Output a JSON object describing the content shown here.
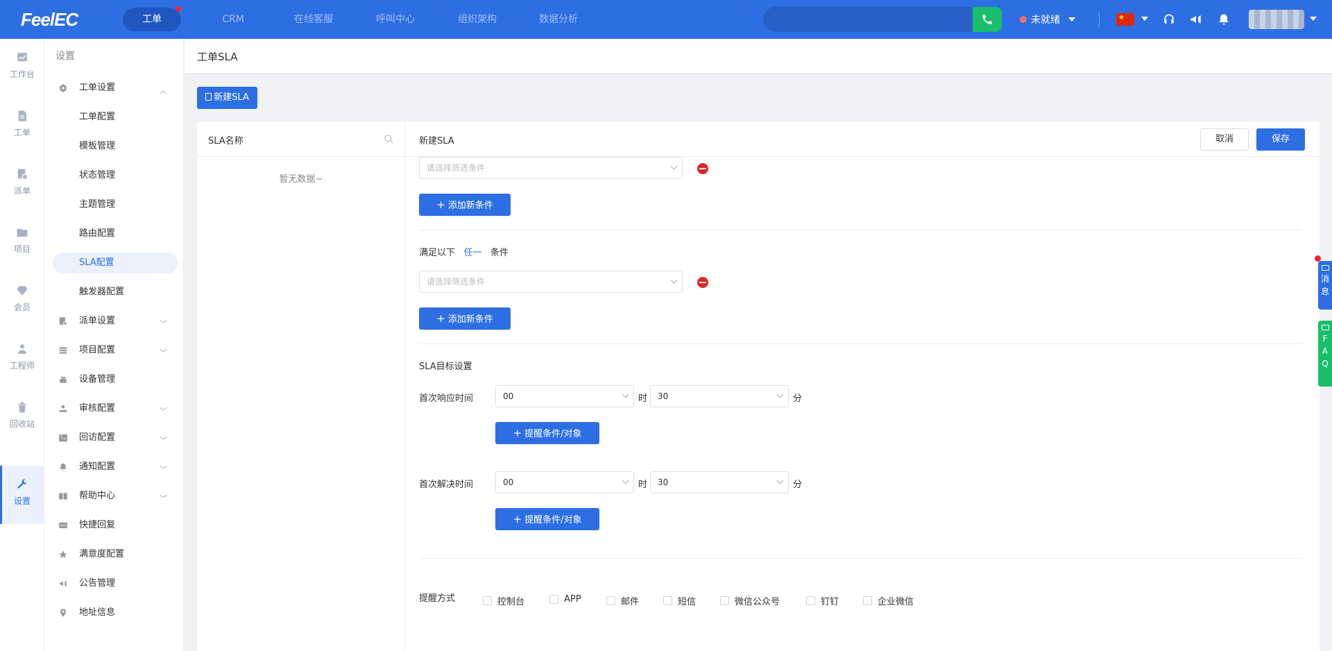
{
  "app": {
    "logo": "FeelEC"
  },
  "topnav": {
    "tabs": [
      {
        "label": "工单"
      },
      {
        "label": "CRM"
      },
      {
        "label": "在线客服"
      },
      {
        "label": "呼叫中心"
      },
      {
        "label": "组织架构"
      },
      {
        "label": "数据分析"
      }
    ],
    "status": "未就绪",
    "accent": "#2d6fe3"
  },
  "rail": {
    "items": [
      {
        "label": "工作台",
        "icon": "chart-icon"
      },
      {
        "label": "工单",
        "icon": "document-icon"
      },
      {
        "label": "派单",
        "icon": "dispatch-icon"
      },
      {
        "label": "项目",
        "icon": "folder-icon"
      },
      {
        "label": "会员",
        "icon": "diamond-icon"
      },
      {
        "label": "工程师",
        "icon": "engineer-icon"
      },
      {
        "label": "回收站",
        "icon": "trash-icon"
      },
      {
        "label": "设置",
        "icon": "wrench-icon"
      }
    ]
  },
  "menu": {
    "title": "设置",
    "items": [
      {
        "label": "工单设置"
      },
      {
        "label": "工单配置"
      },
      {
        "label": "模板管理"
      },
      {
        "label": "状态管理"
      },
      {
        "label": "主题管理"
      },
      {
        "label": "路由配置"
      },
      {
        "label": "SLA配置"
      },
      {
        "label": "触发器配置"
      },
      {
        "label": "派单设置"
      },
      {
        "label": "项目配置"
      },
      {
        "label": "设备管理"
      },
      {
        "label": "审核配置"
      },
      {
        "label": "回访配置"
      },
      {
        "label": "通知配置"
      },
      {
        "label": "帮助中心"
      },
      {
        "label": "快捷回复"
      },
      {
        "label": "满意度配置"
      },
      {
        "label": "公告管理"
      },
      {
        "label": "地址信息"
      }
    ]
  },
  "page": {
    "title": "工单SLA",
    "new_button": "新建SLA",
    "list": {
      "header": "SLA名称",
      "empty": "暂无数据~"
    },
    "form": {
      "title": "新建SLA",
      "cancel": "取消",
      "save": "保存",
      "filter_placeholder": "请选择筛选条件",
      "add_condition": "添加新条件",
      "any_prefix": "满足以下",
      "any_link": "任一",
      "any_suffix": "条件",
      "target_title": "SLA目标设置",
      "first_response": {
        "label": "首次响应时间",
        "hours": "00",
        "minutes": "30"
      },
      "first_resolve": {
        "label": "首次解决时间",
        "hours": "00",
        "minutes": "30"
      },
      "hour_unit": "时",
      "minute_unit": "分",
      "reminder_button": "提醒条件/对象",
      "notify_label": "提醒方式",
      "notify_options": [
        "控制台",
        "APP",
        "邮件",
        "短信",
        "微信公众号",
        "钉钉",
        "企业微信"
      ]
    }
  },
  "float": {
    "message": "消息",
    "faq": "FAQ"
  }
}
